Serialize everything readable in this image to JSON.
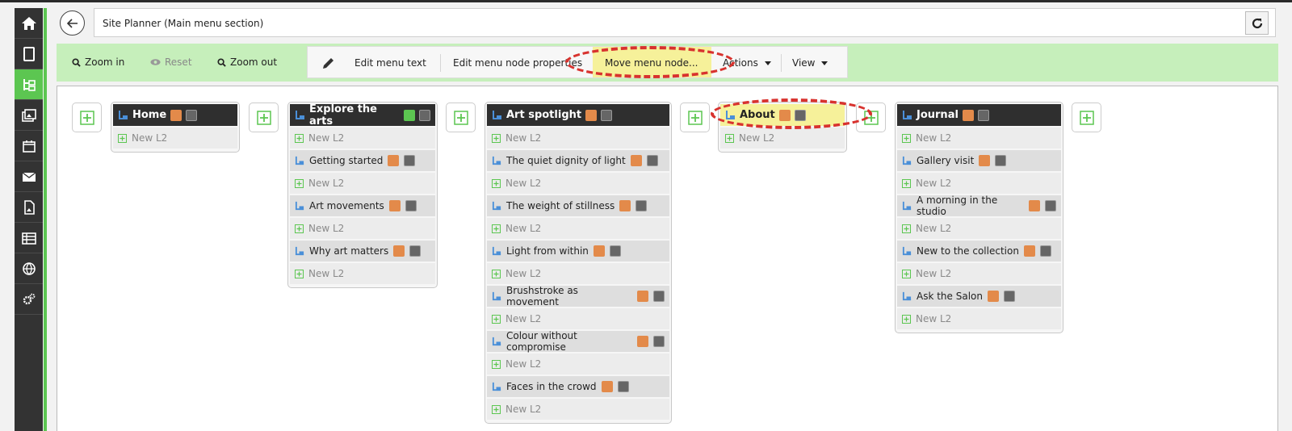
{
  "title": "Site Planner (Main menu section)",
  "sidebar": {
    "items": [
      {
        "icon": "home-icon"
      },
      {
        "icon": "tablet-icon"
      },
      {
        "icon": "sitemap-icon",
        "active": true
      },
      {
        "icon": "images-icon"
      },
      {
        "icon": "calendar-icon"
      },
      {
        "icon": "mail-icon"
      },
      {
        "icon": "file-image-icon"
      },
      {
        "icon": "table-icon"
      },
      {
        "icon": "globe-icon"
      },
      {
        "icon": "gears-icon"
      }
    ]
  },
  "toolbar": {
    "zoom_in": "Zoom in",
    "reset": "Reset",
    "zoom_out": "Zoom out",
    "edit_menu_text": "Edit menu text",
    "edit_node_props": "Edit menu node properties",
    "move_node": "Move menu node...",
    "actions": "Actions",
    "view": "View"
  },
  "menu": {
    "new_l2": "New L2",
    "columns": [
      {
        "title": "Home",
        "items": []
      },
      {
        "title": "Explore the arts",
        "items": [
          "Getting started",
          "Art movements",
          "Why art matters"
        ]
      },
      {
        "title": "Art spotlight",
        "items": [
          "The quiet dignity of light",
          "The weight of stillness",
          "Light from within",
          "Brushstroke as movement",
          "Colour without compromise",
          "Faces in the crowd"
        ]
      },
      {
        "title": "About",
        "items": []
      },
      {
        "title": "Journal",
        "items": [
          "Gallery visit",
          "A morning in the studio",
          "New to the collection",
          "Ask the Salon"
        ]
      }
    ]
  },
  "colors": {
    "sidebar": "#333333",
    "accent_green": "#5cc651",
    "toolbar_bg": "#c6efbb",
    "highlight_yellow": "#f6f19a",
    "annotation_red": "#d8322e",
    "page_icon": "#e38a4a"
  }
}
